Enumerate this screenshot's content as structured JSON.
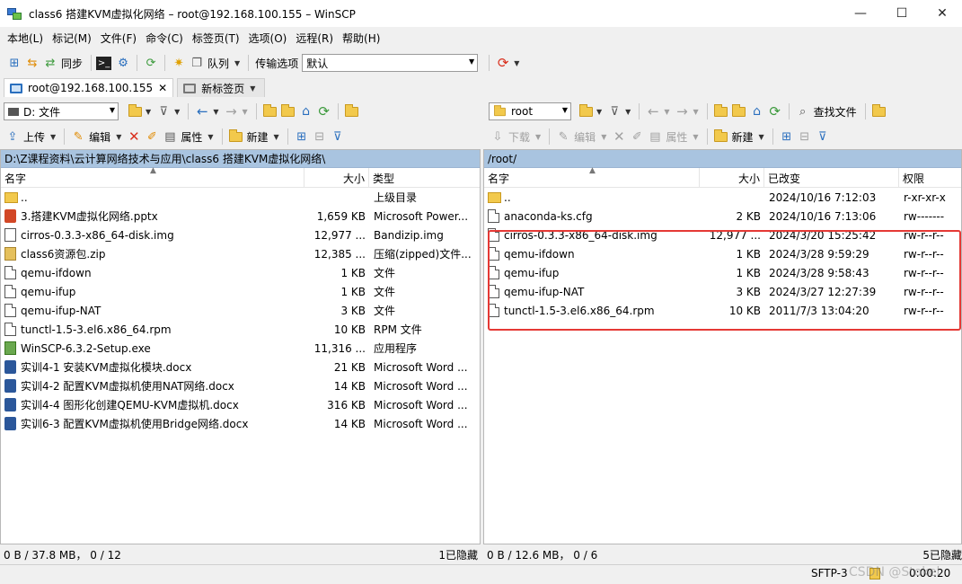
{
  "window": {
    "title": "class6 搭建KVM虚拟化网络 – root@192.168.100.155 – WinSCP",
    "minimize": "—",
    "maximize": "☐",
    "close": "✕"
  },
  "menu": [
    "本地(L)",
    "标记(M)",
    "文件(F)",
    "命令(C)",
    "标签页(T)",
    "选项(O)",
    "远程(R)",
    "帮助(H)"
  ],
  "toolbar_main": {
    "sync_label": "同步",
    "queue_label": "队列",
    "transfer_label": "传输选项",
    "transfer_value": "默认"
  },
  "tabs": [
    {
      "label": "root@192.168.100.155",
      "close": "✕"
    },
    {
      "label": "新标签页"
    }
  ],
  "left": {
    "drive": "D: 文件",
    "upload_label": "上传",
    "edit_label": "编辑",
    "props_label": "属性",
    "new_label": "新建",
    "path": "D:\\Z课程资料\\云计算网络技术与应用\\class6 搭建KVM虚拟化网络\\",
    "columns": {
      "name": "名字",
      "size": "大小",
      "type": "类型"
    },
    "files": [
      {
        "name": "..",
        "size": "",
        "type": "上级目录",
        "icon": "up"
      },
      {
        "name": "3.搭建KVM虚拟化网络.pptx",
        "size": "1,659 KB",
        "type": "Microsoft Power...",
        "icon": "ppt"
      },
      {
        "name": "cirros-0.3.3-x86_64-disk.img",
        "size": "12,977 ...",
        "type": "Bandizip.img",
        "icon": "img"
      },
      {
        "name": "class6资源包.zip",
        "size": "12,385 ...",
        "type": "压缩(zipped)文件...",
        "icon": "zip"
      },
      {
        "name": "qemu-ifdown",
        "size": "1 KB",
        "type": "文件",
        "icon": "doc"
      },
      {
        "name": "qemu-ifup",
        "size": "1 KB",
        "type": "文件",
        "icon": "doc"
      },
      {
        "name": "qemu-ifup-NAT",
        "size": "3 KB",
        "type": "文件",
        "icon": "doc"
      },
      {
        "name": "tunctl-1.5-3.el6.x86_64.rpm",
        "size": "10 KB",
        "type": "RPM 文件",
        "icon": "doc"
      },
      {
        "name": "WinSCP-6.3.2-Setup.exe",
        "size": "11,316 ...",
        "type": "应用程序",
        "icon": "exe"
      },
      {
        "name": "实训4-1 安装KVM虚拟化模块.docx",
        "size": "21 KB",
        "type": "Microsoft Word ...",
        "icon": "word"
      },
      {
        "name": "实训4-2 配置KVM虚拟机使用NAT网络.docx",
        "size": "14 KB",
        "type": "Microsoft Word ...",
        "icon": "word"
      },
      {
        "name": "实训4-4 图形化创建QEMU-KVM虚拟机.docx",
        "size": "316 KB",
        "type": "Microsoft Word ...",
        "icon": "word"
      },
      {
        "name": "实训6-3 配置KVM虚拟机使用Bridge网络.docx",
        "size": "14 KB",
        "type": "Microsoft Word ...",
        "icon": "word"
      }
    ],
    "status": "0 B / 37.8 MB， 0 / 12",
    "hidden": "1已隐藏"
  },
  "right": {
    "dir": "root",
    "find_label": "查找文件",
    "download_label": "下载",
    "edit_label": "编辑",
    "props_label": "属性",
    "new_label": "新建",
    "path": "/root/",
    "columns": {
      "name": "名字",
      "size": "大小",
      "modified": "已改变",
      "perms": "权限"
    },
    "files": [
      {
        "name": "..",
        "size": "",
        "modified": "2024/10/16 7:12:03",
        "perms": "r-xr-xr-x",
        "icon": "up"
      },
      {
        "name": "anaconda-ks.cfg",
        "size": "2 KB",
        "modified": "2024/10/16 7:13:06",
        "perms": "rw-------",
        "icon": "doc"
      },
      {
        "name": "cirros-0.3.3-x86_64-disk.img",
        "size": "12,977 ...",
        "modified": "2024/3/20 15:25:42",
        "perms": "rw-r--r--",
        "icon": "doc"
      },
      {
        "name": "qemu-ifdown",
        "size": "1 KB",
        "modified": "2024/3/28 9:59:29",
        "perms": "rw-r--r--",
        "icon": "doc"
      },
      {
        "name": "qemu-ifup",
        "size": "1 KB",
        "modified": "2024/3/28 9:58:43",
        "perms": "rw-r--r--",
        "icon": "doc"
      },
      {
        "name": "qemu-ifup-NAT",
        "size": "3 KB",
        "modified": "2024/3/27 12:27:39",
        "perms": "rw-r--r--",
        "icon": "doc"
      },
      {
        "name": "tunctl-1.5-3.el6.x86_64.rpm",
        "size": "10 KB",
        "modified": "2011/7/3 13:04:20",
        "perms": "rw-r--r--",
        "icon": "doc"
      }
    ],
    "status": "0 B / 12.6 MB， 0 / 6",
    "hidden": "5已隐藏"
  },
  "bottom": {
    "protocol": "SFTP-3",
    "elapsed": "0:00:20",
    "watermark": "CSDN @Stokel"
  },
  "colors": {
    "pathbar": "#a9c4e0",
    "highlight_box": "#e53935"
  }
}
